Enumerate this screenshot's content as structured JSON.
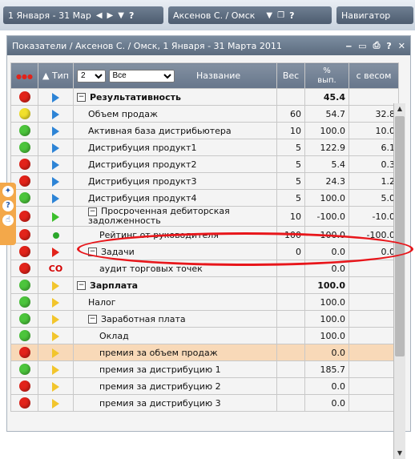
{
  "topbar": {
    "date_range": "1 Января - 31 Мар",
    "user": "Аксенов С. / Омск",
    "help": "?",
    "navigator": "Навигатор"
  },
  "panel": {
    "title": "Показатели / Аксенов С. / Омск, 1 Января - 31 Марта 2011",
    "ctl_min": "‒",
    "ctl_restore": "▭",
    "ctl_print": "⎙",
    "ctl_help": "?",
    "ctl_close": "✕"
  },
  "table": {
    "headers": {
      "type": "▲ Тип",
      "level": "2",
      "filter": "Все",
      "name": "Название",
      "weight": "Вес",
      "percent": "%\nвып.",
      "weighted": "с весом"
    },
    "rows": [
      {
        "status": "red",
        "icon": "tri-blue",
        "name": "Результативность",
        "exp": "−",
        "bold": true,
        "weight": "",
        "percent": "45.4",
        "weighted": ""
      },
      {
        "status": "yellow",
        "icon": "tri-blue",
        "name": "Объем продаж",
        "exp": "",
        "bold": false,
        "weight": "60",
        "percent": "54.7",
        "weighted": "32.8"
      },
      {
        "status": "green",
        "icon": "tri-blue",
        "name": "Активная база дистрибьютера",
        "exp": "",
        "bold": false,
        "weight": "10",
        "percent": "100.0",
        "weighted": "10.0"
      },
      {
        "status": "green",
        "icon": "tri-blue",
        "name": "Дистрибуция продукт1",
        "exp": "",
        "bold": false,
        "weight": "5",
        "percent": "122.9",
        "weighted": "6.1"
      },
      {
        "status": "red",
        "icon": "tri-blue",
        "name": "Дистрибуция продукт2",
        "exp": "",
        "bold": false,
        "weight": "5",
        "percent": "5.4",
        "weighted": "0.3"
      },
      {
        "status": "red",
        "icon": "tri-blue",
        "name": "Дистрибуция продукт3",
        "exp": "",
        "bold": false,
        "weight": "5",
        "percent": "24.3",
        "weighted": "1.2"
      },
      {
        "status": "green",
        "icon": "tri-blue",
        "name": "Дистрибуция продукт4",
        "exp": "",
        "bold": false,
        "weight": "5",
        "percent": "100.0",
        "weighted": "5.0"
      },
      {
        "status": "red",
        "icon": "tri-green",
        "name": "Просроченная дебиторская задолженность",
        "exp": "−",
        "bold": false,
        "weight": "10",
        "percent": "-100.0",
        "weighted": "-10.0"
      },
      {
        "status": "red",
        "icon": "dot-green",
        "name": "Рейтинг от руководителя",
        "exp": "",
        "bold": false,
        "weight": "100",
        "percent": "-100.0",
        "weighted": "-100.0"
      },
      {
        "status": "red",
        "icon": "tri-red",
        "name": "Задачи",
        "exp": "−",
        "bold": false,
        "weight": "0",
        "percent": "0.0",
        "weighted": "0.0"
      },
      {
        "status": "red",
        "icon": "co",
        "name": "аудит торговых точек",
        "exp": "",
        "bold": false,
        "weight": "",
        "percent": "0.0",
        "weighted": ""
      },
      {
        "status": "green",
        "icon": "tri-yellow",
        "name": "Зарплата",
        "exp": "−",
        "bold": true,
        "weight": "",
        "percent": "100.0",
        "weighted": ""
      },
      {
        "status": "green",
        "icon": "tri-yellow",
        "name": "Налог",
        "exp": "",
        "bold": false,
        "weight": "",
        "percent": "100.0",
        "weighted": ""
      },
      {
        "status": "green",
        "icon": "tri-yellow",
        "name": "Заработная плата",
        "exp": "−",
        "bold": false,
        "weight": "",
        "percent": "100.0",
        "weighted": ""
      },
      {
        "status": "green",
        "icon": "tri-yellow",
        "name": "Оклад",
        "exp": "",
        "bold": false,
        "weight": "",
        "percent": "100.0",
        "weighted": ""
      },
      {
        "status": "red",
        "icon": "tri-yellow",
        "name": "премия за объем продаж",
        "exp": "",
        "bold": false,
        "weight": "",
        "percent": "0.0",
        "weighted": ""
      },
      {
        "status": "green",
        "icon": "tri-yellow",
        "name": "премия за дистрибуцию 1",
        "exp": "",
        "bold": false,
        "weight": "",
        "percent": "185.7",
        "weighted": ""
      },
      {
        "status": "red",
        "icon": "tri-yellow",
        "name": "премия за дистрибуцию 2",
        "exp": "",
        "bold": false,
        "weight": "",
        "percent": "0.0",
        "weighted": ""
      },
      {
        "status": "red",
        "icon": "tri-yellow",
        "name": "премия за дистрибуцию 3",
        "exp": "",
        "bold": false,
        "weight": "",
        "percent": "0.0",
        "weighted": ""
      }
    ]
  },
  "colors": {
    "red_status": "#e2231a",
    "green_status": "#4cc53c",
    "yellow_status": "#f1e02c",
    "highlight_row": "#f8d9b8",
    "annotation_oval": "#e8161b"
  }
}
